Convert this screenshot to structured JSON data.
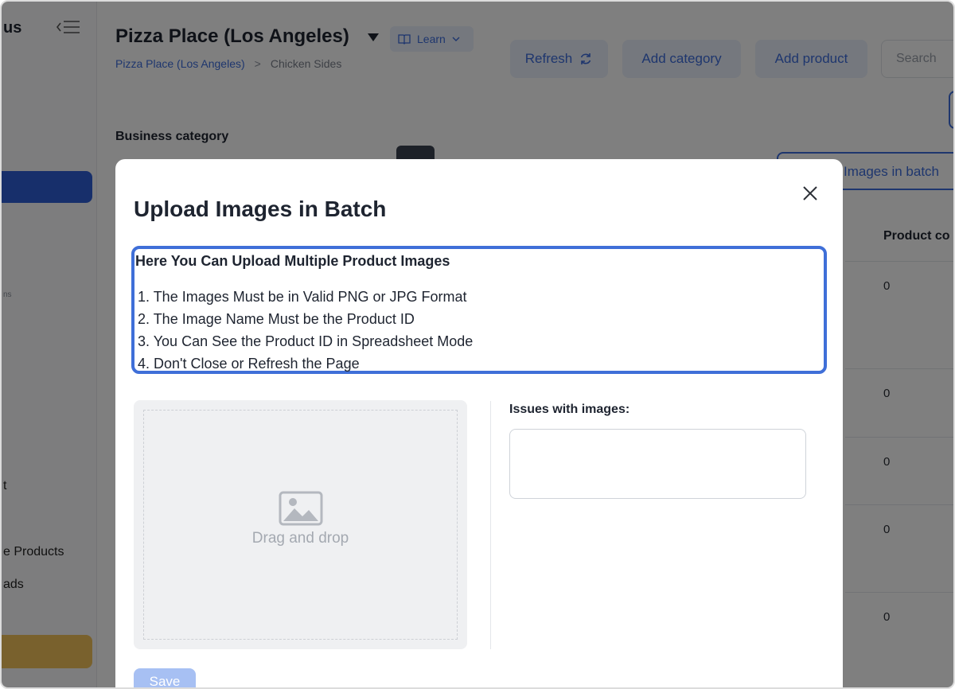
{
  "app": {
    "brand": "us",
    "sidebar": {
      "tiny_label": "ns",
      "item_t": "t",
      "item_products": "e Products",
      "item_ads": "ads"
    }
  },
  "header": {
    "title": "Pizza Place (Los Angeles)",
    "learn_label": "Learn",
    "breadcrumb": {
      "root": "Pizza Place (Los Angeles)",
      "separator": ">",
      "current": "Chicken Sides"
    },
    "buttons": {
      "refresh": "Refresh",
      "add_category": "Add category",
      "add_product": "Add product"
    },
    "search_placeholder": "Search"
  },
  "content": {
    "business_category": "Business category",
    "batch_button": "Images in batch",
    "column_header": "Product co",
    "cells": [
      "0",
      "0",
      "0",
      "0",
      "0"
    ]
  },
  "modal": {
    "title": "Upload Images in Batch",
    "instructions_heading": "Here You Can Upload Multiple Product Images",
    "instructions": [
      "1. The Images Must be in Valid PNG or JPG Format",
      "2. The Image Name Must be the Product ID",
      "3. You Can See the Product ID in Spreadsheet Mode",
      "4. Don't Close or Refresh the Page"
    ],
    "dropzone_text": "Drag and drop",
    "issues_label": "Issues with images:",
    "save_label": "Save"
  },
  "colors": {
    "accent": "#3d6ddc",
    "save_disabled": "#a7c0f3",
    "overlay": "rgba(0,0,0,0.5)"
  }
}
